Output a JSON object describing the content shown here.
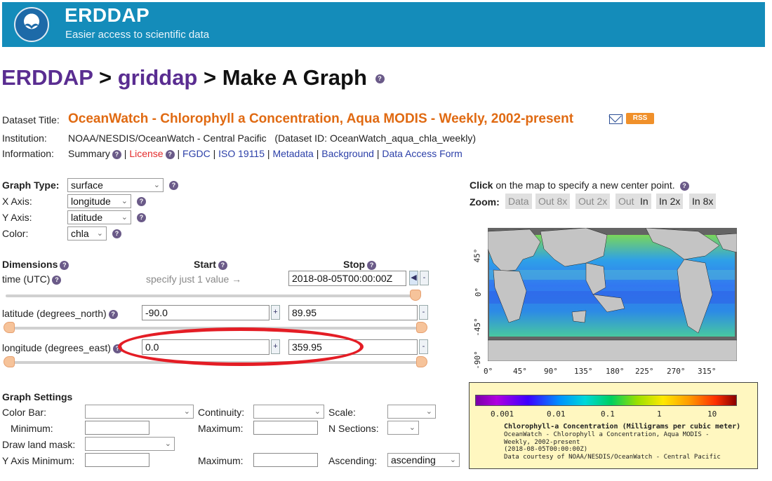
{
  "header": {
    "brand": "ERDDAP",
    "tagline": "Easier access to scientific data",
    "logo_text": "NOAA"
  },
  "breadcrumb": {
    "root": "ERDDAP",
    "sep1": ">",
    "section": "griddap",
    "sep2": ">",
    "page": "Make A Graph"
  },
  "dataset": {
    "title_label": "Dataset Title:",
    "title": "OceanWatch - Chlorophyll a Concentration, Aqua MODIS - Weekly, 2002-present",
    "rss": "RSS",
    "institution_label": "Institution:",
    "institution": "NOAA/NESDIS/OceanWatch - Central Pacific",
    "dataset_id": "(Dataset ID: OceanWatch_aqua_chla_weekly)",
    "information_label": "Information:",
    "info_links": {
      "summary": "Summary",
      "license": "License",
      "fgdc": "FGDC",
      "iso": "ISO 19115",
      "metadata": "Metadata",
      "background": "Background",
      "access_form": "Data Access Form"
    },
    "sep": "|"
  },
  "graph": {
    "type_label": "Graph Type:",
    "type_value": "surface",
    "x_label": "X Axis:",
    "x_value": "longitude",
    "y_label": "Y Axis:",
    "y_value": "latitude",
    "color_label": "Color:",
    "color_value": "chla"
  },
  "dimensions": {
    "header": "Dimensions",
    "start_header": "Start",
    "stop_header": "Stop",
    "time_label": "time (UTC)",
    "time_hint": "specify just 1 value →",
    "time_stop": "2018-08-05T00:00:00Z",
    "lat_label": "latitude (degrees_north)",
    "lat_start": "-90.0",
    "lat_stop": "89.95",
    "lon_label": "longitude (degrees_east)",
    "lon_start": "0.0",
    "lon_stop": "359.95",
    "plus": "+",
    "minus": "-"
  },
  "settings": {
    "header": "Graph Settings",
    "color_bar_label": "Color Bar:",
    "continuity_label": "Continuity:",
    "scale_label": "Scale:",
    "minimum_label": "Minimum:",
    "maximum_label": "Maximum:",
    "nsections_label": "N Sections:",
    "land_mask_label": "Draw land mask:",
    "y_min_label": "Y Axis Minimum:",
    "y_max_label": "Maximum:",
    "ascending_label": "Ascending:",
    "ascending_value": "ascending"
  },
  "map": {
    "click_bold": "Click",
    "click_rest": "on the map to specify a new center point.",
    "zoom_label": "Zoom:",
    "zoom_buttons": [
      "Data",
      "Out 8x",
      "Out 2x",
      "Out",
      "In",
      "In 2x",
      "In 8x"
    ],
    "lat_ticks": [
      "45°",
      "0°",
      "-45°",
      "-90°"
    ],
    "lon_ticks": [
      "0°",
      "45°",
      "90°",
      "135°",
      "180°",
      "225°",
      "270°",
      "315°"
    ]
  },
  "colorbar": {
    "ticks": [
      "0.001",
      "0.01",
      "0.1",
      "1",
      "10"
    ],
    "title": "Chlorophyll-a Concentration (Milligrams per cubic meter)",
    "line1": "OceanWatch - Chlorophyll a Concentration, Aqua MODIS -",
    "line2": "Weekly, 2002-present",
    "line3": "(2018-08-05T00:00:00Z)",
    "line4": "Data courtesy of NOAA/NESDIS/OceanWatch - Central Pacific"
  },
  "colors": {
    "banner": "#148cba",
    "title_orange": "#e06a12",
    "link_blue": "#2b3fa8",
    "crumb_purple": "#5a2d91",
    "annotation_red": "#e41d25"
  }
}
